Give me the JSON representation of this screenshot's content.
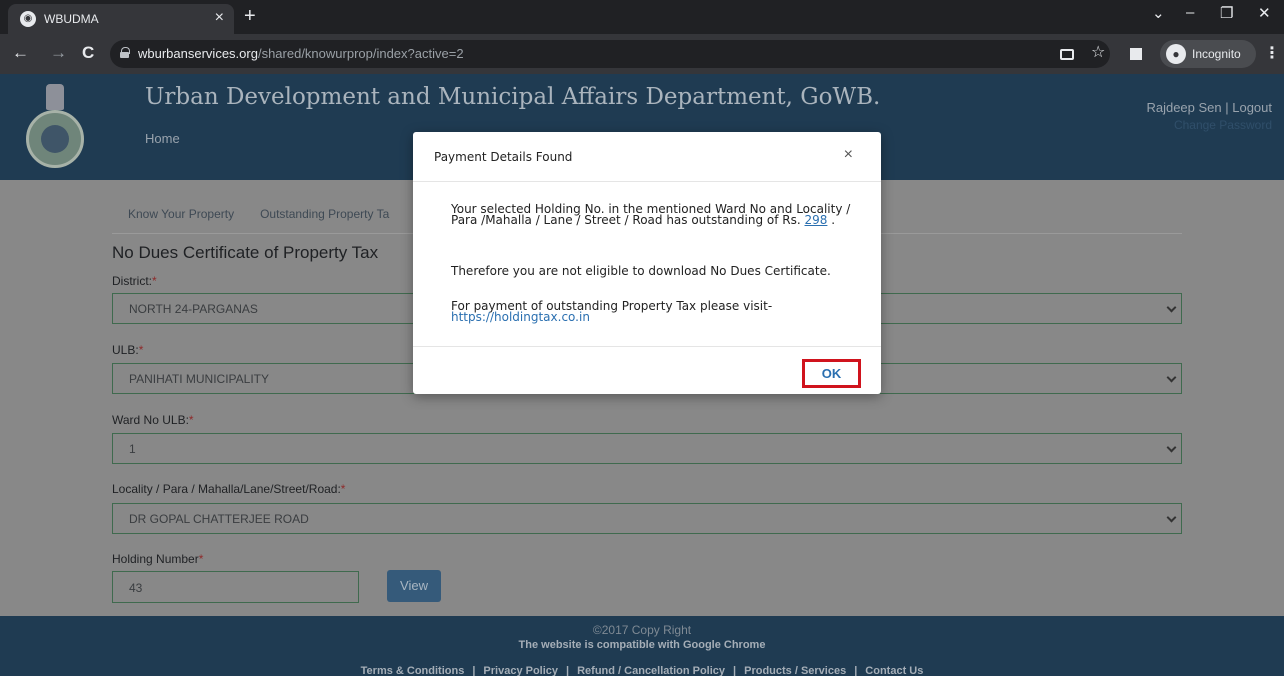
{
  "browser": {
    "tab_title": "WBUDMA",
    "tab_close": "×",
    "new_tab": "+",
    "url_host": "wburbanservices.org",
    "url_path": "/shared/knowurprop/index?active=2",
    "back": "←",
    "forward": "→",
    "reload": "C",
    "star": "☆",
    "incognito_label": "Incognito",
    "menu": "⋮",
    "win_minimize": "–",
    "win_restore": "❐",
    "win_close": "✕",
    "tab_search": "⌄"
  },
  "header": {
    "title": "Urban Development and Municipal Affairs Department, GoWB.",
    "home_link": "Home",
    "user": "Rajdeep Sen | Logout",
    "change_password": "Change Password"
  },
  "subnav": {
    "items": [
      "Know Your Property",
      "Outstanding Property Ta"
    ]
  },
  "form": {
    "title": "No Dues Certificate of Property Tax",
    "district_label": "District:",
    "district_value": "NORTH 24-PARGANAS",
    "ulb_label": "ULB:",
    "ulb_value": "PANIHATI MUNICIPALITY",
    "ward_label": "Ward No ULB:",
    "ward_value": "1",
    "locality_label": "Locality / Para / Mahalla/Lane/Street/Road:",
    "locality_value": "DR GOPAL CHATTERJEE ROAD",
    "holding_label": "Holding Number",
    "holding_value": "43",
    "view_button": "View",
    "required_mark": "*"
  },
  "footer": {
    "copyright": "©2017 Copy Right",
    "compat": "The website is compatible with Google Chrome",
    "links": [
      "Terms & Conditions",
      "Privacy Policy",
      "Refund / Cancellation Policy",
      "Products / Services",
      "Contact Us"
    ],
    "separator": "|"
  },
  "modal": {
    "title": "Payment Details Found",
    "close": "×",
    "p1_text": "Your selected Holding No. in the mentioned Ward No and Locality / Para /Mahalla / Lane / Street / Road has outstanding of Rs.",
    "amount": "298",
    "p1_end": ".",
    "p2": "Therefore you are not eligible to download No Dues Certificate.",
    "p3": "For payment of outstanding Property Tax please visit-",
    "link": "https://holdingtax.co.in",
    "ok_button": "OK"
  }
}
